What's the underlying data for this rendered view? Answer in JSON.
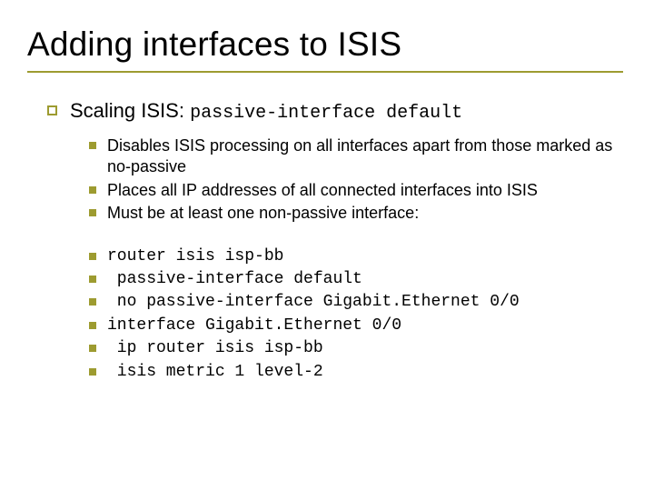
{
  "title": "Adding interfaces to ISIS",
  "level1": {
    "prefix": "Scaling ISIS: ",
    "mono": "passive-interface default"
  },
  "bullets_desc": [
    "Disables ISIS processing on all interfaces apart from those marked as no-passive",
    "Places all IP addresses of all connected interfaces into ISIS",
    "Must be at least one non-passive interface:"
  ],
  "bullets_code": [
    "router isis isp-bb",
    " passive-interface default",
    " no passive-interface Gigabit.Ethernet 0/0",
    "interface Gigabit.Ethernet 0/0",
    " ip router isis isp-bb",
    " isis metric 1 level-2"
  ]
}
